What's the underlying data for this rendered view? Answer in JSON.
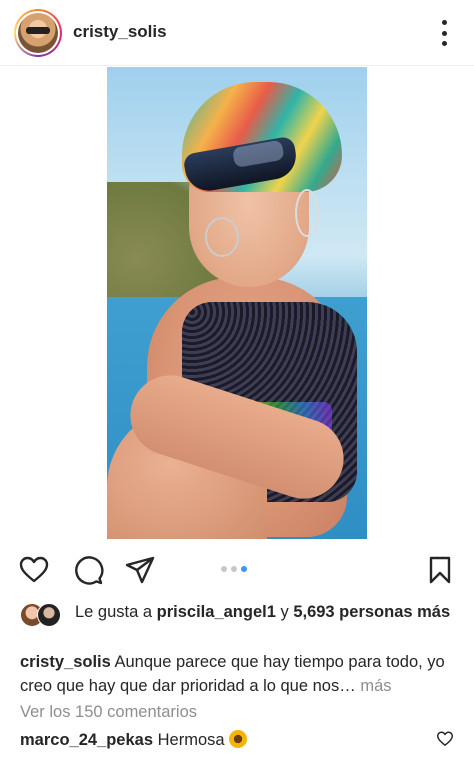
{
  "post": {
    "username": "cristy_solis",
    "image_alt": "post photo"
  },
  "carousel": {
    "total": 3,
    "active_index": 2
  },
  "likes": {
    "prefix": "Le gusta a ",
    "liker": "priscila_angel1",
    "middle": " y ",
    "count_text": "5,693 personas más"
  },
  "caption": {
    "username": "cristy_solis",
    "text": "Aunque parece que hay tiempo para todo, yo creo que hay que dar prioridad a lo que nos",
    "ellipsis": "…",
    "more_label": "más"
  },
  "comments": {
    "view_all": "Ver los 150 comentarios",
    "items": [
      {
        "username": "marco_24_pekas",
        "text": "Hermosa"
      }
    ]
  },
  "icons": {
    "like": "heart-icon",
    "comment": "comment-icon",
    "share": "paper-plane-icon",
    "save": "bookmark-icon",
    "more": "more-vertical-icon"
  },
  "colors": {
    "text": "#262626",
    "secondary": "#8e8e8e",
    "carousel_active": "#3897f0"
  }
}
